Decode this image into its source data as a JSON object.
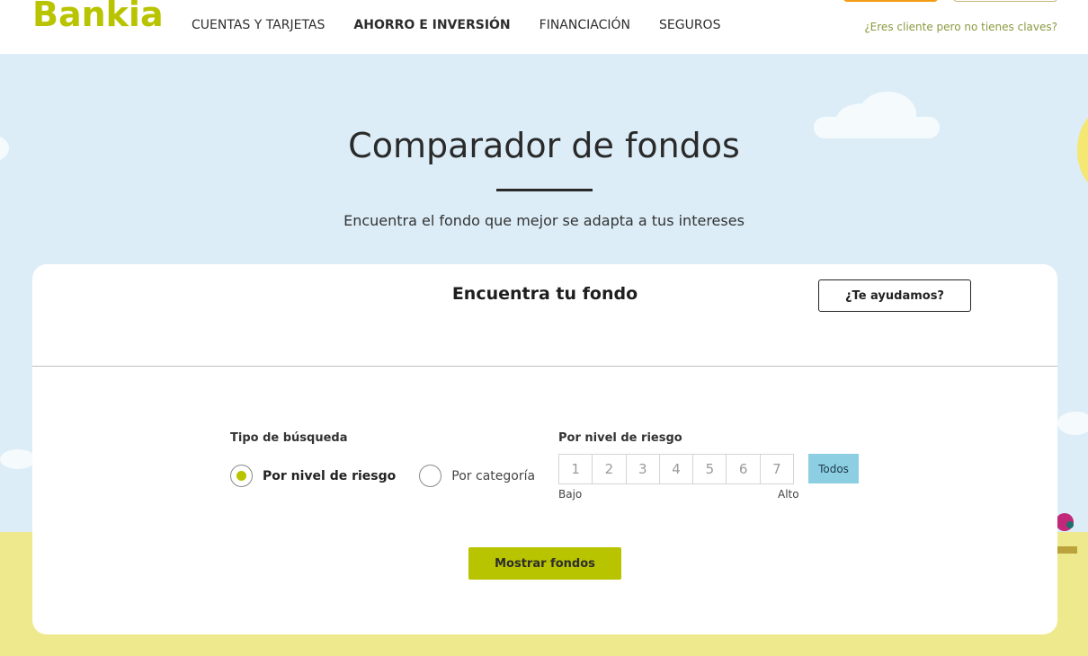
{
  "header": {
    "logo": "Bankia",
    "nav": [
      {
        "label": "CUENTAS Y TARJETAS"
      },
      {
        "label": "AHORRO E INVERSIÓN"
      },
      {
        "label": "FINANCIACIÓN"
      },
      {
        "label": "SEGUROS"
      }
    ],
    "client_link": "¿Eres cliente pero no tienes claves?"
  },
  "hero": {
    "title": "Comparador de fondos",
    "subtitle": "Encuentra el fondo que mejor se adapta a tus intereses"
  },
  "card": {
    "title": "Encuentra tu fondo",
    "help_button": "¿Te ayudamos?",
    "search_type": {
      "label": "Tipo de búsqueda",
      "options": [
        {
          "label": "Por nivel de riesgo",
          "selected": true
        },
        {
          "label": "Por categoría",
          "selected": false
        }
      ]
    },
    "risk": {
      "label": "Por nivel de riesgo",
      "levels": [
        "1",
        "2",
        "3",
        "4",
        "5",
        "6",
        "7"
      ],
      "all_button": "Todos",
      "low_label": "Bajo",
      "high_label": "Alto"
    },
    "submit_button": "Mostrar fondos"
  },
  "colors": {
    "brand_green": "#b9c400",
    "sky": "#dcedf7",
    "ground": "#eee98c",
    "todos_blue": "#8ccfe3"
  }
}
